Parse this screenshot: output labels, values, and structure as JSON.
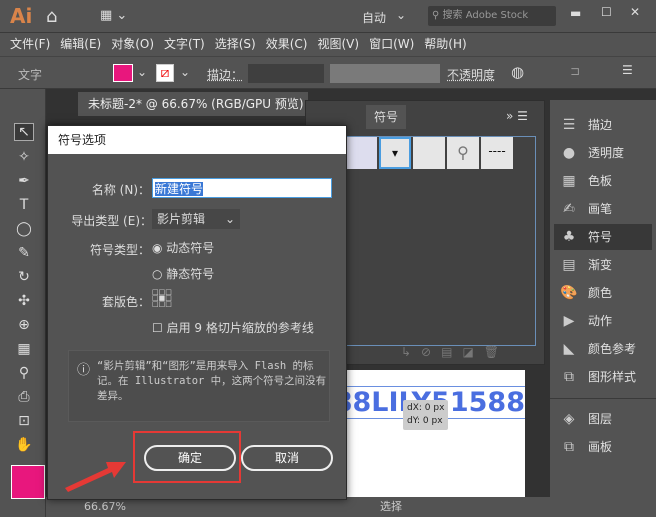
{
  "app": {
    "logo": "Ai",
    "workspace": "自动",
    "search_placeholder": "搜索 Adobe Stock"
  },
  "menu": [
    "文件(F)",
    "编辑(E)",
    "对象(O)",
    "文字(T)",
    "选择(S)",
    "效果(C)",
    "视图(V)",
    "窗口(W)",
    "帮助(H)"
  ],
  "control": {
    "mode": "文字",
    "stroke_label": "描边：",
    "opacity_label": "不透明度",
    "fill_color": "#e8177d"
  },
  "document": {
    "tab": "未标题-2* @ 66.67% (RGB/GPU 预览)",
    "canvas_text": "88LILY51588",
    "dx": "dX: 0 px",
    "dy": "dY: 0 px",
    "zoom": "66.67%",
    "status": "选择"
  },
  "symbols_panel": {
    "tab": "符号"
  },
  "right_panel": {
    "items": [
      {
        "label": "描边",
        "icon": "stroke-icon"
      },
      {
        "label": "透明度",
        "icon": "transparency-icon"
      },
      {
        "label": "色板",
        "icon": "swatches-icon"
      },
      {
        "label": "画笔",
        "icon": "brush-icon"
      },
      {
        "label": "符号",
        "icon": "club-icon"
      },
      {
        "label": "渐变",
        "icon": "gradient-icon"
      },
      {
        "label": "颜色",
        "icon": "palette-icon"
      },
      {
        "label": "动作",
        "icon": "play-icon"
      },
      {
        "label": "颜色参考",
        "icon": "color-guide-icon"
      },
      {
        "label": "图形样式",
        "icon": "graphic-styles-icon"
      }
    ],
    "items2": [
      {
        "label": "图层",
        "icon": "layers-icon"
      },
      {
        "label": "画板",
        "icon": "artboards-icon"
      }
    ]
  },
  "dialog": {
    "title": "符号选项",
    "name_label": "名称 (N)：",
    "name_value": "新建符号",
    "export_label": "导出类型 (E)：",
    "export_value": "影片剪辑",
    "type_label": "符号类型：",
    "type_dynamic": "动态符号",
    "type_static": "静态符号",
    "registration_label": "套版色：",
    "nine_slice": "启用 9 格切片缩放的参考线",
    "info": "“影片剪辑”和“图形”是用来导入 Flash 的标记。在 Illustrator 中，这两个符号之间没有差异。",
    "ok": "确定",
    "cancel": "取消"
  },
  "accent": {
    "highlight": "#e53935",
    "fill": "#e8177d",
    "canvas_text": "#4a6ee0"
  }
}
